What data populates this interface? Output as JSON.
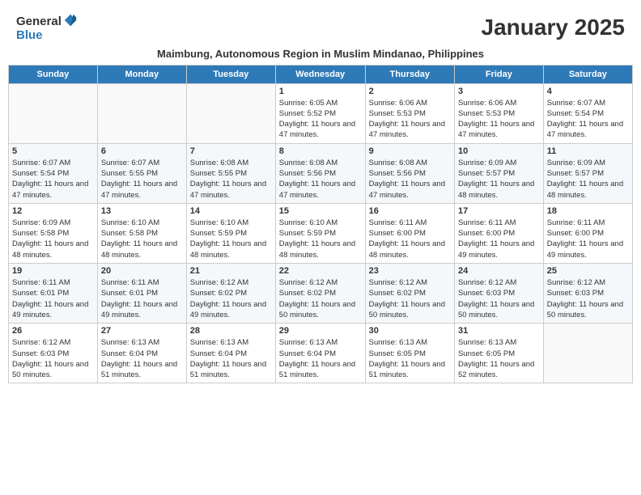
{
  "header": {
    "logo_general": "General",
    "logo_blue": "Blue",
    "month_title": "January 2025",
    "subtitle": "Maimbung, Autonomous Region in Muslim Mindanao, Philippines"
  },
  "days_of_week": [
    "Sunday",
    "Monday",
    "Tuesday",
    "Wednesday",
    "Thursday",
    "Friday",
    "Saturday"
  ],
  "weeks": [
    [
      {
        "day": "",
        "info": ""
      },
      {
        "day": "",
        "info": ""
      },
      {
        "day": "",
        "info": ""
      },
      {
        "day": "1",
        "info": "Sunrise: 6:05 AM\nSunset: 5:52 PM\nDaylight: 11 hours and 47 minutes."
      },
      {
        "day": "2",
        "info": "Sunrise: 6:06 AM\nSunset: 5:53 PM\nDaylight: 11 hours and 47 minutes."
      },
      {
        "day": "3",
        "info": "Sunrise: 6:06 AM\nSunset: 5:53 PM\nDaylight: 11 hours and 47 minutes."
      },
      {
        "day": "4",
        "info": "Sunrise: 6:07 AM\nSunset: 5:54 PM\nDaylight: 11 hours and 47 minutes."
      }
    ],
    [
      {
        "day": "5",
        "info": "Sunrise: 6:07 AM\nSunset: 5:54 PM\nDaylight: 11 hours and 47 minutes."
      },
      {
        "day": "6",
        "info": "Sunrise: 6:07 AM\nSunset: 5:55 PM\nDaylight: 11 hours and 47 minutes."
      },
      {
        "day": "7",
        "info": "Sunrise: 6:08 AM\nSunset: 5:55 PM\nDaylight: 11 hours and 47 minutes."
      },
      {
        "day": "8",
        "info": "Sunrise: 6:08 AM\nSunset: 5:56 PM\nDaylight: 11 hours and 47 minutes."
      },
      {
        "day": "9",
        "info": "Sunrise: 6:08 AM\nSunset: 5:56 PM\nDaylight: 11 hours and 47 minutes."
      },
      {
        "day": "10",
        "info": "Sunrise: 6:09 AM\nSunset: 5:57 PM\nDaylight: 11 hours and 48 minutes."
      },
      {
        "day": "11",
        "info": "Sunrise: 6:09 AM\nSunset: 5:57 PM\nDaylight: 11 hours and 48 minutes."
      }
    ],
    [
      {
        "day": "12",
        "info": "Sunrise: 6:09 AM\nSunset: 5:58 PM\nDaylight: 11 hours and 48 minutes."
      },
      {
        "day": "13",
        "info": "Sunrise: 6:10 AM\nSunset: 5:58 PM\nDaylight: 11 hours and 48 minutes."
      },
      {
        "day": "14",
        "info": "Sunrise: 6:10 AM\nSunset: 5:59 PM\nDaylight: 11 hours and 48 minutes."
      },
      {
        "day": "15",
        "info": "Sunrise: 6:10 AM\nSunset: 5:59 PM\nDaylight: 11 hours and 48 minutes."
      },
      {
        "day": "16",
        "info": "Sunrise: 6:11 AM\nSunset: 6:00 PM\nDaylight: 11 hours and 48 minutes."
      },
      {
        "day": "17",
        "info": "Sunrise: 6:11 AM\nSunset: 6:00 PM\nDaylight: 11 hours and 49 minutes."
      },
      {
        "day": "18",
        "info": "Sunrise: 6:11 AM\nSunset: 6:00 PM\nDaylight: 11 hours and 49 minutes."
      }
    ],
    [
      {
        "day": "19",
        "info": "Sunrise: 6:11 AM\nSunset: 6:01 PM\nDaylight: 11 hours and 49 minutes."
      },
      {
        "day": "20",
        "info": "Sunrise: 6:11 AM\nSunset: 6:01 PM\nDaylight: 11 hours and 49 minutes."
      },
      {
        "day": "21",
        "info": "Sunrise: 6:12 AM\nSunset: 6:02 PM\nDaylight: 11 hours and 49 minutes."
      },
      {
        "day": "22",
        "info": "Sunrise: 6:12 AM\nSunset: 6:02 PM\nDaylight: 11 hours and 50 minutes."
      },
      {
        "day": "23",
        "info": "Sunrise: 6:12 AM\nSunset: 6:02 PM\nDaylight: 11 hours and 50 minutes."
      },
      {
        "day": "24",
        "info": "Sunrise: 6:12 AM\nSunset: 6:03 PM\nDaylight: 11 hours and 50 minutes."
      },
      {
        "day": "25",
        "info": "Sunrise: 6:12 AM\nSunset: 6:03 PM\nDaylight: 11 hours and 50 minutes."
      }
    ],
    [
      {
        "day": "26",
        "info": "Sunrise: 6:12 AM\nSunset: 6:03 PM\nDaylight: 11 hours and 50 minutes."
      },
      {
        "day": "27",
        "info": "Sunrise: 6:13 AM\nSunset: 6:04 PM\nDaylight: 11 hours and 51 minutes."
      },
      {
        "day": "28",
        "info": "Sunrise: 6:13 AM\nSunset: 6:04 PM\nDaylight: 11 hours and 51 minutes."
      },
      {
        "day": "29",
        "info": "Sunrise: 6:13 AM\nSunset: 6:04 PM\nDaylight: 11 hours and 51 minutes."
      },
      {
        "day": "30",
        "info": "Sunrise: 6:13 AM\nSunset: 6:05 PM\nDaylight: 11 hours and 51 minutes."
      },
      {
        "day": "31",
        "info": "Sunrise: 6:13 AM\nSunset: 6:05 PM\nDaylight: 11 hours and 52 minutes."
      },
      {
        "day": "",
        "info": ""
      }
    ]
  ]
}
